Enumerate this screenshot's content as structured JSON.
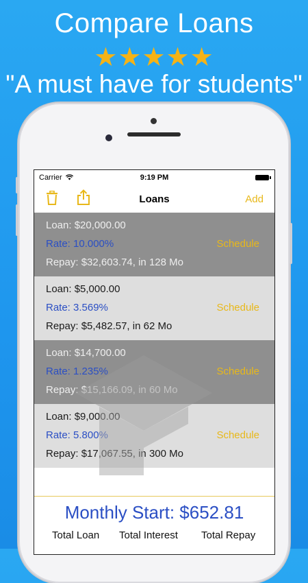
{
  "promo": {
    "title": "Compare Loans",
    "stars": "★★★★★",
    "tagline": "\"A must have for students\""
  },
  "status_bar": {
    "carrier": "Carrier",
    "time": "9:19 PM"
  },
  "nav": {
    "title": "Loans",
    "add_label": "Add"
  },
  "loans": [
    {
      "loan": "Loan: $20,000.00",
      "rate": "Rate: 10.000%",
      "repay": "Repay: $32,603.74, in 128 Mo",
      "action": "Schedule",
      "shade": "dark"
    },
    {
      "loan": "Loan: $5,000.00",
      "rate": "Rate: 3.569%",
      "repay": "Repay: $5,482.57, in 62 Mo",
      "action": "Schedule",
      "shade": "light"
    },
    {
      "loan": "Loan: $14,700.00",
      "rate": "Rate: 1.235%",
      "repay": "Repay: $15,166.09, in 60 Mo",
      "action": "Schedule",
      "shade": "dark"
    },
    {
      "loan": "Loan: $9,000.00",
      "rate": "Rate: 5.800%",
      "repay": "Repay: $17,067.55, in 300 Mo",
      "action": "Schedule",
      "shade": "light"
    }
  ],
  "summary": {
    "monthly_start": "Monthly Start: $652.81",
    "total_loan_label": "Total Loan",
    "total_interest_label": "Total Interest",
    "total_repay_label": "Total Repay"
  },
  "colors": {
    "accent": "#e8b81a",
    "rate_blue": "#2b4fc4",
    "background": "#1e96ee",
    "star": "#f5b316"
  },
  "icons": [
    "trash-icon",
    "share-icon",
    "wifi-icon",
    "battery-icon",
    "graduation-cap-icon"
  ]
}
